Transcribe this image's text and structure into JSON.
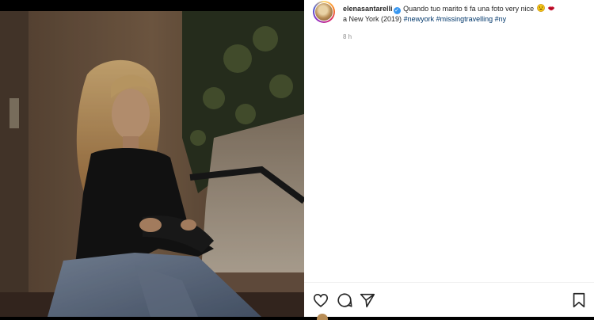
{
  "post": {
    "username": "elenasantarelli",
    "verified_icon": "verified-badge-icon",
    "caption_text": "Quando tuo marito ti fa una foto very nice",
    "caption_line2": "a New York (2019)",
    "hashtags": [
      "#newyork",
      "#missingtravelling",
      "#ny"
    ],
    "emojis": [
      "grinning-face-icon",
      "lips-icon"
    ],
    "timestamp": "8 h"
  },
  "photo": {
    "description_icon": "photo-image"
  },
  "actions": {
    "like_icon": "heart-icon",
    "comment_icon": "comment-icon",
    "share_icon": "share-icon",
    "save_icon": "bookmark-icon"
  },
  "colors": {
    "background": "#000000",
    "panel": "#ffffff",
    "text": "#262626",
    "hashtag": "#00376b",
    "muted": "#8e8e8e",
    "verified": "#3897f0"
  }
}
